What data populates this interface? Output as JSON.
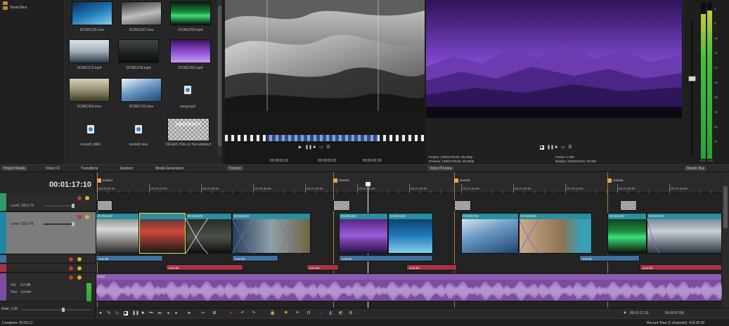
{
  "project_tree": {
    "smart_bins": "Smart Bins"
  },
  "media": [
    {
      "name": "DCIM1232.mov",
      "kind": "video",
      "palette": [
        "#1d6aa8",
        "#6fc2e8"
      ]
    },
    {
      "name": "DCIM1267.mov",
      "kind": "video",
      "palette": [
        "#8a8a8a",
        "#e2e2e2"
      ]
    },
    {
      "name": "DCIM1293.mp4",
      "kind": "video",
      "palette": [
        "#0f3b1d",
        "#35e06a"
      ]
    },
    {
      "name": "DCIM1372.mp4",
      "kind": "video",
      "palette": [
        "#5a6b7c",
        "#d8dde2"
      ]
    },
    {
      "name": "DCIM1378.mp4",
      "kind": "video",
      "palette": [
        "#1b1f1b",
        "#7f8a70"
      ]
    },
    {
      "name": "DCIM1392.mp4",
      "kind": "video",
      "palette": [
        "#4d1e7a",
        "#b27ae8"
      ]
    },
    {
      "name": "DCIM1463.mov",
      "kind": "video",
      "palette": [
        "#4a4a36",
        "#b4b090"
      ]
    },
    {
      "name": "DCIM1723.mov",
      "kind": "video",
      "palette": [
        "#3d6ea0",
        "#e5eef5"
      ]
    },
    {
      "name": "song.mp3",
      "kind": "audio"
    },
    {
      "name": "sound1.WAV",
      "kind": "audio"
    },
    {
      "name": "sound2.wav",
      "kind": "audio"
    },
    {
      "name": "VEGAS Titles & Text abstract",
      "kind": "title",
      "thumb_text": "ABSTRACT"
    }
  ],
  "trimmer": {
    "time_in": "00:00:01:01",
    "time_out": "00:00:03:21",
    "time_length": "00:00:02:20"
  },
  "preview": {
    "project_label": "Project:",
    "project_value": "1280x720x32; 25,000p",
    "preview_label": "Preview:",
    "preview_value": "1280x720x32; 25,000p",
    "frame_label": "Frame:",
    "frame_value": "1.935",
    "display_label": "Display:",
    "display_value": "608x376x32; 25,000"
  },
  "master_bus": {
    "left_readout": "-1.4",
    "right_readout": "-1.4",
    "scale": [
      "3",
      "9",
      "15",
      "21",
      "27",
      "33",
      "39",
      "45",
      "51",
      "57"
    ],
    "left_level": 0.93,
    "right_level": 0.95
  },
  "tabs": [
    {
      "label": "Project Media",
      "active": true
    },
    {
      "label": "Video FX"
    },
    {
      "label": "Transitions"
    },
    {
      "label": "Explorer"
    },
    {
      "label": "Media Generators"
    },
    {
      "label": "Trimmer",
      "active": true
    },
    {
      "label": "Video Preview",
      "active": true
    },
    {
      "label": "Master Bus",
      "active": true
    }
  ],
  "timeline": {
    "current_time": "00:01:17:10",
    "markers": [
      "scene1",
      "scene2",
      "scene3",
      "scene4"
    ],
    "ruler_ticks": [
      "00:00:00:00",
      "00:00:15:00",
      "00:00:30:00",
      "00:00:45:00",
      "00:01:00:00",
      "00:01:15:00",
      "00:01:30:00",
      "00:01:45:00",
      "00:02:00:00",
      "00:02:15:00",
      "00:02:30:00",
      "00:02:45:00"
    ],
    "video_clips": [
      "DCIM1267",
      "",
      "DCIM1378",
      "DCIM1463",
      "DCIM1392",
      "DCIM1232",
      "DCIM1723",
      "DCIM1026",
      "DCIM1293",
      "DCIM1272"
    ],
    "audio_row1": [
      "sound1",
      "sound1",
      "sound1",
      "sound1"
    ],
    "audio_row2": [
      "sound2",
      "sound2",
      "sound2",
      "sound2"
    ],
    "song_label": "song"
  },
  "tracks": {
    "track1_level": "Level: 100,0 %",
    "track2_level": "Level: 100,0 %",
    "vol_label": "Vol:",
    "vol_value": "0,0 dB",
    "pan_label": "Pan:",
    "pan_value": "Center",
    "rate_label": "Rate:",
    "rate_value": "1,00"
  },
  "transport": {
    "cursor_time": "00:01:17:10",
    "end_time": "00:02:57:09"
  },
  "status": {
    "complete": "Complete: 00:00:12",
    "record_time": "Record Time (2 channels): 410:26:00"
  },
  "colors": {
    "accent_marker": "#f0a54a",
    "video_clip": "#2a8fa0",
    "audio_clip": "#3d6f9f",
    "sound2_clip": "#a53444",
    "song_track": "#7c4ca0"
  }
}
